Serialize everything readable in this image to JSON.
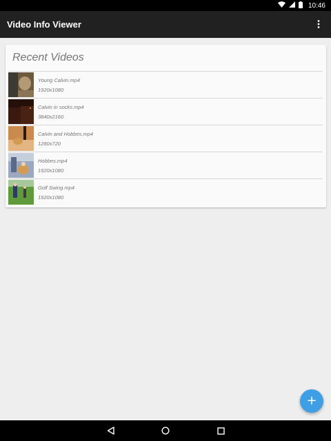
{
  "status_bar": {
    "time": "10:46",
    "icons": [
      "wifi-icon",
      "cellular-signal-icon",
      "battery-icon"
    ]
  },
  "app_bar": {
    "title": "Video Info Viewer",
    "overflow_icon": "more-vert-icon"
  },
  "card": {
    "title": "Recent Videos",
    "videos": [
      {
        "name": "Young Calvin.mp4",
        "resolution": "1920x1080",
        "thumb_colors": [
          "#6b5a3e",
          "#b39a74",
          "#3d3a33"
        ]
      },
      {
        "name": "Calvin in socks.mp4",
        "resolution": "3840x2160",
        "thumb_colors": [
          "#3a1a10",
          "#5a2a18",
          "#241008"
        ]
      },
      {
        "name": "Calvin and Hobbes.mp4",
        "resolution": "1280x720",
        "thumb_colors": [
          "#c98a4e",
          "#e2b583",
          "#5a3a1c"
        ]
      },
      {
        "name": "Hobbes.mp4",
        "resolution": "1920x1080",
        "thumb_colors": [
          "#9aa8c0",
          "#d39a52",
          "#5a6a88"
        ]
      },
      {
        "name": "Golf Swing.mp4",
        "resolution": "1920x1080",
        "thumb_colors": [
          "#5f9a3c",
          "#2c3a6a",
          "#a7c89a"
        ]
      }
    ]
  },
  "fab": {
    "icon": "add-icon",
    "label": "+",
    "color": "#3f9fe6"
  },
  "nav_bar": {
    "icons": [
      "back-icon",
      "home-icon",
      "recents-icon"
    ]
  },
  "colors": {
    "app_bar": "#212121",
    "background": "#eeeeee",
    "card": "#fafafa",
    "muted_text": "#757575"
  }
}
